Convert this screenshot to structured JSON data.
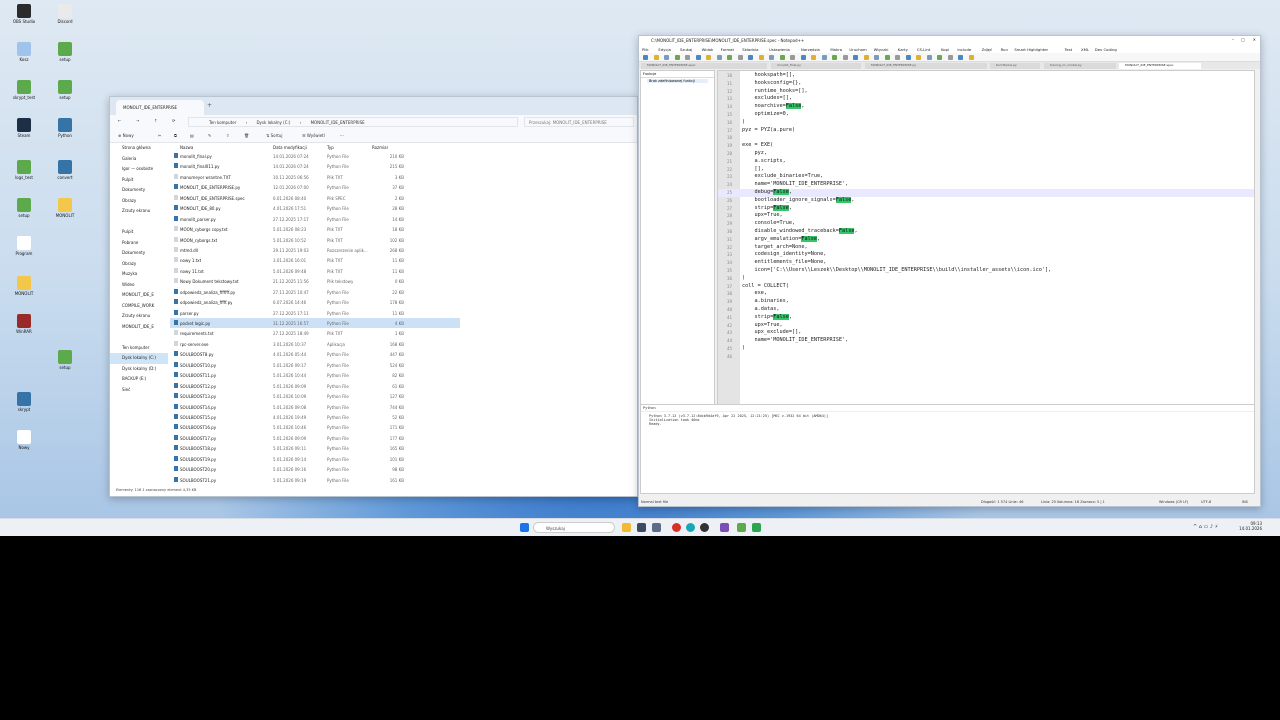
{
  "desktop_icons": [
    {
      "label": "OBS Studio",
      "color": "#2b2b2b"
    },
    {
      "label": "Discord",
      "color": "#eaeaea"
    },
    {
      "label": "Kosz",
      "color": "#9fc3ea"
    },
    {
      "label": "setup",
      "color": "#5caa4c"
    },
    {
      "label": "skrypt_test",
      "color": "#5caa4c"
    },
    {
      "label": "setup",
      "color": "#5caa4c"
    },
    {
      "label": "Steam",
      "color": "#1c2f44"
    },
    {
      "label": "Python",
      "color": "#3673a6"
    },
    {
      "label": "logs_test",
      "color": "#5caa4c"
    },
    {
      "label": "convert",
      "color": "#3673a6"
    },
    {
      "label": "setup",
      "color": "#5caa4c"
    },
    {
      "label": "MONOLIT",
      "color": "#f3c74a"
    },
    {
      "label": "Program",
      "color": "#ffffff"
    },
    {
      "label": "MONOLIT",
      "color": "#f3c74a"
    },
    {
      "label": "WinRAR",
      "color": "#9a2a2a"
    },
    {
      "label": "setup",
      "color": "#5caa4c"
    },
    {
      "label": "skrypt",
      "color": "#3673a6"
    },
    {
      "label": "Nowy",
      "color": "#ffffff"
    }
  ],
  "explorer": {
    "tab_title": "MONOLIT_IDE_ENTERPRISE",
    "breadcrumb": [
      "Ten komputer",
      "Dysk lokalny (C:)",
      "MONOLIT_IDE_ENTERPRISE"
    ],
    "search_placeholder": "Przeszukaj: MONOLIT_IDE_ENTERPRISE",
    "toolbar": {
      "new": "Nowy",
      "sort": "Sortuj",
      "view": "Wyświetl"
    },
    "columns": [
      "Nazwa",
      "Data modyfikacji",
      "Typ",
      "Rozmiar"
    ],
    "nav": [
      {
        "label": "Strona główna"
      },
      {
        "label": "Galeria"
      },
      {
        "label": "Igor — osobiste"
      },
      {
        "label": "Pulpit"
      },
      {
        "label": "Dokumenty"
      },
      {
        "label": "Obrazy"
      },
      {
        "label": "Zrzuty ekranu"
      },
      {
        "label": ""
      },
      {
        "label": "Pulpit"
      },
      {
        "label": "Pobrane"
      },
      {
        "label": "Dokumenty"
      },
      {
        "label": "Obrazy"
      },
      {
        "label": "Muzyka"
      },
      {
        "label": "Wideo"
      },
      {
        "label": "MONOLIT_IDE_E"
      },
      {
        "label": "COMPILE_WORK"
      },
      {
        "label": "Zrzuty ekranu"
      },
      {
        "label": "MONOLIT_IDE_E"
      },
      {
        "label": ""
      },
      {
        "label": "Ten komputer"
      },
      {
        "label": "Dysk lokalny (C:)"
      },
      {
        "label": "Dysk lokalny (D:)"
      },
      {
        "label": "BACKUP (E:)"
      },
      {
        "label": "Sieć"
      }
    ],
    "files": [
      [
        "monolit_final.py",
        "14.01.2026 07:24",
        "Python File",
        "210 KB"
      ],
      [
        "monolit_final011.py",
        "14.01.2026 07:24",
        "Python File",
        "215 KB"
      ],
      [
        "manumeyor wrantne.TXT",
        "10.11.2025 06:56",
        "Plik TXT",
        "3 KB"
      ],
      [
        "MONOLIT_IDE_ENTERPRISE.py",
        "12.01.2026 07:00",
        "Python File",
        "37 KB"
      ],
      [
        "MONOLIT_IDE_ENTERPRISE.spec",
        "6.01.2026 08:40",
        "Plik SPEC",
        "2 KB"
      ],
      [
        "MONOLIT_IDE_80.py",
        "4.01.2026 17:51",
        "Python File",
        "28 KB"
      ],
      [
        "monolit_parser.py",
        "27.12.2025 17:17",
        "Python File",
        "14 KB"
      ],
      [
        "MOON_cyborgs copy.txt",
        "5.01.2026 08:23",
        "Plik TXT",
        "18 KB"
      ],
      [
        "MOON_cyborgs.txt",
        "5.01.2026 10:52",
        "Plik TXT",
        "102 KB"
      ],
      [
        "mtmd.dll",
        "29.11.2025 19:03",
        "Rozszerzenie aplik...",
        "268 KB"
      ],
      [
        "nowy 1.txt",
        "3.01.2026 16:01",
        "Plik TXT",
        "11 KB"
      ],
      [
        "nowy 11.txt",
        "5.01.2026 09:48",
        "Plik TXT",
        "11 KB"
      ],
      [
        "Nowy Dokument tekstowy.txt",
        "21.12.2025 11:56",
        "Plik tekstowy",
        "0 KB"
      ],
      [
        "odpowiedz_analiza_fffffff.py",
        "27.11.2025 10:47",
        "Python File",
        "22 KB"
      ],
      [
        "odpowiedz_analiza_fffff.py",
        "6.07.2026 14:46",
        "Python File",
        "178 KB"
      ],
      [
        "parser.py",
        "27.12.2025 17:11",
        "Python File",
        "11 KB"
      ],
      [
        "pocket logic.py",
        "31.12.2025 16:57",
        "Python File",
        "4 KB"
      ],
      [
        "requirements.txt",
        "27.12.2025 18:49",
        "Plik TXT",
        "1 KB"
      ],
      [
        "rpc-server.exe",
        "3.01.2026 10:37",
        "Aplikacja",
        "168 KB"
      ],
      [
        "SOULBOOST8.py",
        "4.01.2026 05:44",
        "Python File",
        "447 KB"
      ],
      [
        "SOULBOOST10.py",
        "5.01.2026 09:17",
        "Python File",
        "524 KB"
      ],
      [
        "SOULBOOST11.py",
        "5.01.2026 10:44",
        "Python File",
        "82 KB"
      ],
      [
        "SOULBOOST12.py",
        "5.01.2026 09:09",
        "Python File",
        "61 KB"
      ],
      [
        "SOULBOOST13.py",
        "5.01.2026 10:09",
        "Python File",
        "127 KB"
      ],
      [
        "SOULBOOST14.py",
        "5.01.2026 09:08",
        "Python File",
        "744 KB"
      ],
      [
        "SOULBOOST15.py",
        "4.01.2026 19:49",
        "Python File",
        "52 KB"
      ],
      [
        "SOULBOOST16.py",
        "5.01.2026 10:46",
        "Python File",
        "171 KB"
      ],
      [
        "SOULBOOST17.py",
        "5.01.2026 09:09",
        "Python File",
        "177 KB"
      ],
      [
        "SOULBOOST18.py",
        "5.01.2026 09:11",
        "Python File",
        "165 KB"
      ],
      [
        "SOULBOOST19.py",
        "5.01.2026 09:14",
        "Python File",
        "101 KB"
      ],
      [
        "SOULBOOST20.py",
        "5.01.2026 09:16",
        "Python File",
        "98 KB"
      ],
      [
        "SOULBOOST21.py",
        "5.01.2026 09:19",
        "Python File",
        "161 KB"
      ]
    ],
    "status": "Elementy: 116     1 zaznaczony element   4,35 KB"
  },
  "npp": {
    "title": "C:\\MONOLIT_IDE_ENTERPRISE\\MONOLIT_IDE_ENTERPRISE.spec - Notepad++",
    "menu": [
      "Plik",
      "Edycja",
      "Szukaj",
      "Widok",
      "Format",
      "Składnia",
      "Ustawienia",
      "Narzędzia",
      "Makra",
      "Uruchom",
      "Wtyczki",
      "Karty",
      "CS-Lint",
      "Kopi",
      "Include",
      "Zdjęć",
      "Run",
      "Smart Highlighter",
      "Test",
      "XML",
      "Dev Coding"
    ],
    "tabs": [
      "MONOLIT_IDE_ENTERPRISE.spec",
      "monolit_final.py",
      "MONOLIT_IDE_ENTERPRISE.py",
      "Kod Mailus.py",
      "trening_nn_model.py",
      "MONOLIT_IDE_ENTERPRISE.spec"
    ],
    "left_panel_title": "Funkcje",
    "left_panel_item": "Brak zdefiniowanej funkcji",
    "code": [
      {
        "n": "10",
        "t": "    hookspath=[],"
      },
      {
        "n": "11",
        "t": "    hooksconfig={},"
      },
      {
        "n": "12",
        "t": "    runtime_hooks=[],"
      },
      {
        "n": "13",
        "t": "    excludes=[],"
      },
      {
        "n": "14",
        "t": "    noarchive=",
        "h": "False",
        "e": ","
      },
      {
        "n": "15",
        "t": "    optimize=0,"
      },
      {
        "n": "16",
        "t": ")"
      },
      {
        "n": "17",
        "t": "pyz = PYZ(a.pure)"
      },
      {
        "n": "18",
        "t": ""
      },
      {
        "n": "19",
        "t": "exe = EXE("
      },
      {
        "n": "20",
        "t": "    pyz,"
      },
      {
        "n": "21",
        "t": "    a.scripts,"
      },
      {
        "n": "22",
        "t": "    [],"
      },
      {
        "n": "23",
        "t": "    exclude_binaries=True,"
      },
      {
        "n": "24",
        "t": "    name='MONOLIT_IDE_ENTERPRISE',"
      },
      {
        "n": "25",
        "t": "    debug=",
        "h": "False",
        "e": ","
      },
      {
        "n": "26",
        "t": "    bootloader_ignore_signals=",
        "h": "False",
        "e": ","
      },
      {
        "n": "27",
        "t": "    strip=",
        "h": "False",
        "e": ","
      },
      {
        "n": "28",
        "t": "    upx=True,"
      },
      {
        "n": "29",
        "t": "    console=True,"
      },
      {
        "n": "30",
        "t": "    disable_windowed_traceback=",
        "h": "False",
        "e": ","
      },
      {
        "n": "31",
        "t": "    argv_emulation=",
        "h": "False",
        "e": ","
      },
      {
        "n": "32",
        "t": "    target_arch=None,"
      },
      {
        "n": "33",
        "t": "    codesign_identity=None,"
      },
      {
        "n": "34",
        "t": "    entitlements_file=None,"
      },
      {
        "n": "35",
        "t": "    icon=['C:\\\\Users\\\\Leszek\\\\Desktop\\\\MONOLIT_IDE_ENTERPRISE\\\\build\\\\installer_assets\\\\icon.ico'],"
      },
      {
        "n": "36",
        "t": ")"
      },
      {
        "n": "37",
        "t": "coll = COLLECT("
      },
      {
        "n": "38",
        "t": "    exe,"
      },
      {
        "n": "39",
        "t": "    a.binaries,"
      },
      {
        "n": "40",
        "t": "    a.datas,"
      },
      {
        "n": "41",
        "t": "    strip=",
        "h": "False",
        "e": ","
      },
      {
        "n": "42",
        "t": "    upx=True,"
      },
      {
        "n": "43",
        "t": "    upx_exclude=[],"
      },
      {
        "n": "44",
        "t": "    name='MONOLIT_IDE_ENTERPRISE',"
      },
      {
        "n": "45",
        "t": ")"
      },
      {
        "n": "46",
        "t": ""
      }
    ],
    "output_title": "Python",
    "output_lines": [
      "Python 3.7.12 (v3.7.12:8dcb9d4af9, Apr 22 2025, 12:21:25) [MSC v.1932 64 bit (AMD64)]",
      "Initialization took 46ms",
      "Ready."
    ],
    "status": {
      "file_type": "Normal text file",
      "length": "Długość: 1 574   Linie: 46",
      "position": "Linia: 25   Kolumna: 16   Zaznacz: 5 | 1",
      "eol": "Windows (CR LF)",
      "enc": "UTF-8",
      "mode": "INS"
    }
  },
  "taskbar": {
    "search_placeholder": "Wyszukaj",
    "time": "09:13",
    "date": "14.01.2026"
  }
}
